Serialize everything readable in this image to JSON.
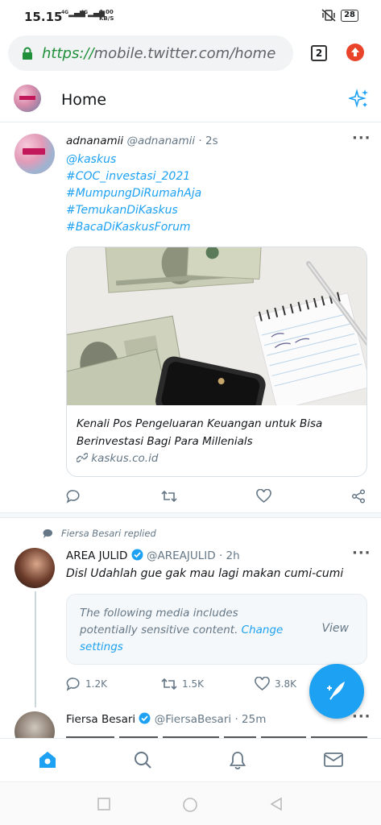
{
  "status_bar": {
    "time": "15.15",
    "network_1": "4G",
    "network_2": "4G",
    "speed_value": "1,00",
    "speed_unit": "KB/S",
    "battery": "28"
  },
  "browser": {
    "url_scheme": "https://",
    "url_host": "mobile.twitter.com",
    "url_path": "/home",
    "tab_count": "2"
  },
  "header": {
    "title": "Home"
  },
  "tweets": [
    {
      "name": "adnanamii",
      "handle": "@adnanamii",
      "time": "· 2s",
      "lines": [
        "@kaskus",
        "#COC_investasi_2021",
        "#MumpungDiRumahAja",
        "#TemukanDiKaskus",
        "#BacaDiKaskusForum"
      ],
      "card": {
        "title": "Kenali Pos Pengeluaran Keuangan untuk Bisa Berinvestasi Bagi Para Millenials",
        "domain": "kaskus.co.id"
      }
    },
    {
      "context": "Fiersa Besari replied",
      "name": "AREA JULID",
      "handle": "@AREAJULID",
      "time": "· 2h",
      "text": "Disl Udahlah gue gak mau lagi makan cumi-cumi",
      "sensitive": {
        "text": "The following media includes potentially sensitive content.",
        "change": "Change settings",
        "view": "View"
      },
      "replies": "1.2K",
      "retweets": "1.5K",
      "likes": "3.8K"
    },
    {
      "name": "Fiersa Besari",
      "handle": "@FiersaBesari",
      "time": "· 25m"
    }
  ],
  "colors": {
    "accent": "#1da1f2",
    "secure_url": "#1f8f3a",
    "muted": "#657786"
  },
  "icons": [
    "lock-icon",
    "sparkle-icon",
    "reply-icon",
    "retweet-icon",
    "like-icon",
    "share-icon",
    "compose-icon",
    "home-icon",
    "search-icon",
    "notifications-icon",
    "messages-icon"
  ]
}
